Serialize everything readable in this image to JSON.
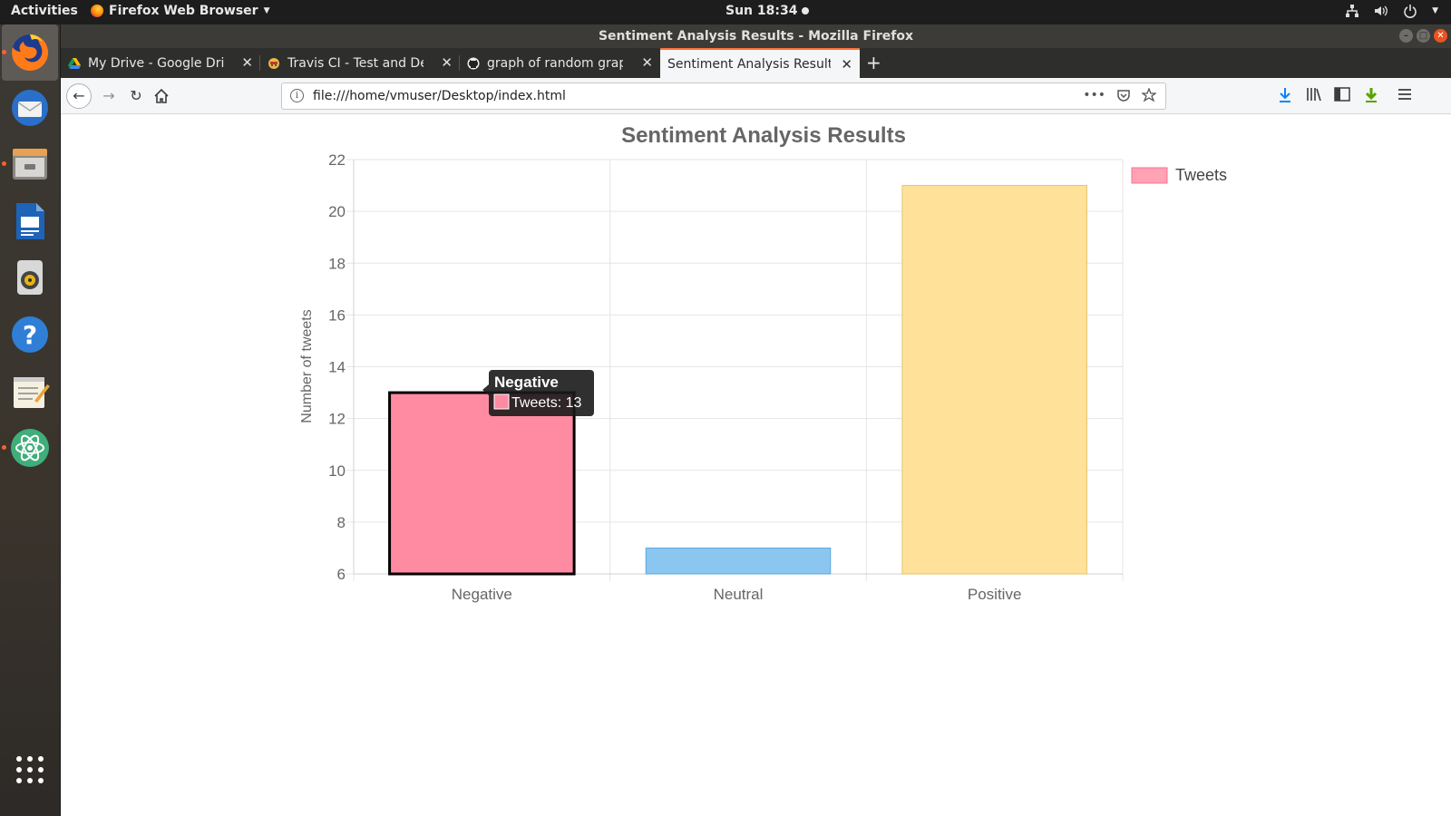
{
  "topbar": {
    "activities": "Activities",
    "app_menu": "Firefox Web Browser",
    "clock": "Sun 18:34"
  },
  "dock": {
    "items": [
      "firefox-icon",
      "thunderbird-icon",
      "files-icon",
      "writer-icon",
      "rhythmbox-icon",
      "help-icon",
      "text-editor-icon",
      "atom-icon",
      "show-apps-icon"
    ]
  },
  "window": {
    "title": "Sentiment Analysis Results - Mozilla Firefox"
  },
  "tabs": [
    {
      "label": "My Drive - Google Drive",
      "icon": "google-drive-icon",
      "selected": false
    },
    {
      "label": "Travis CI - Test and Deplo",
      "icon": "travis-icon",
      "selected": false
    },
    {
      "label": "graph of random graph -",
      "icon": "github-icon",
      "selected": false
    },
    {
      "label": "Sentiment Analysis Results",
      "icon": "",
      "selected": true
    }
  ],
  "navbar": {
    "url": "file:///home/vmuser/Desktop/index.html"
  },
  "chart_data": {
    "type": "bar",
    "title": "Sentiment Analysis Results",
    "xlabel": "",
    "ylabel": "Number of tweets",
    "categories": [
      "Negative",
      "Neutral",
      "Positive"
    ],
    "series": [
      {
        "name": "Tweets",
        "values": [
          13,
          7,
          21
        ]
      }
    ],
    "bar_colors": [
      "#ff8ba2",
      "#8ac6f0",
      "#ffe19a"
    ],
    "border_colors": [
      "#000000",
      "#5fa9dd",
      "#e6c36a"
    ],
    "ylim": [
      6,
      22
    ],
    "yticks": [
      6,
      8,
      10,
      12,
      14,
      16,
      18,
      20,
      22
    ],
    "grid": true,
    "legend": "top-right",
    "legend_color": "#ffa3b5",
    "tooltip": {
      "title": "Negative",
      "label": "Tweets: 13"
    }
  }
}
